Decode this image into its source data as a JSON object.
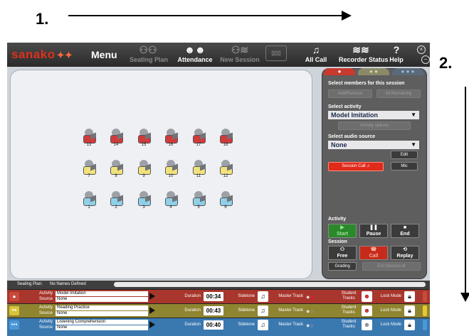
{
  "annotations": {
    "step1": "1.",
    "step2": "2."
  },
  "app": {
    "logo": "sanako",
    "menu": "Menu",
    "toolbar": [
      {
        "label": "Seating Plan",
        "icon": "seating-plan",
        "enabled": false
      },
      {
        "label": "Attendance",
        "icon": "attendance",
        "enabled": true
      },
      {
        "label": "New Session",
        "icon": "new-session",
        "enabled": false
      },
      {
        "label": "",
        "icon": "recorder-device",
        "enabled": false
      },
      {
        "label": "All Call",
        "icon": "all-call",
        "enabled": true
      },
      {
        "label": "Recorder Status",
        "icon": "recorder-status",
        "enabled": true
      },
      {
        "label": "Help",
        "icon": "help",
        "enabled": true
      }
    ],
    "window_buttons": [
      "close",
      "minimize"
    ]
  },
  "seats": {
    "row1": [
      "13",
      "14",
      "15",
      "16",
      "17",
      "18"
    ],
    "row2": [
      "7",
      "8",
      "9",
      "10",
      "11",
      "12"
    ],
    "row3": [
      "1",
      "2",
      "3",
      "4",
      "5",
      "6"
    ],
    "colors": {
      "row1": "#d03a3a",
      "row2": "#f2e27a",
      "row3": "#8fd0e8"
    }
  },
  "panel": {
    "tabs": [
      "●",
      "● ●",
      "● ● ●"
    ],
    "select_members": "Select members for this session",
    "add_remove": "Add/Remove",
    "all_remaining": "All Remaining",
    "select_activity": "Select activity",
    "activity_value": "Model Imitation",
    "activity_options": "Activity options",
    "select_audio": "Select audio source",
    "audio_value": "None",
    "edit": "Edit",
    "session_call": "Session Call",
    "mic": "Mic",
    "activity_heading": "Activity",
    "start": "Start",
    "pause": "Pause",
    "end": "End",
    "session_heading": "Session",
    "free": "Free",
    "call": "Call",
    "replay": "Replay",
    "grading": "Grading",
    "exit_session": "Exit Session"
  },
  "seating_plan": {
    "label": "Seating Plan:",
    "value": "No Names Defined"
  },
  "tracks": [
    {
      "tab": "●",
      "color": "#a8362c",
      "tab_color": "#c84a3a",
      "activity_label": "Activity",
      "activity": "Model Imitation",
      "source_label": "Source",
      "source": "None",
      "duration_label": "Duration",
      "duration": "00:34",
      "sidetone": "Sidetone",
      "master_track": "Master Track",
      "student_tracks": "Student Tracks",
      "lock_mode": "Lock Mode",
      "end_color": "#c84a3a"
    },
    {
      "tab": "●●",
      "color": "#8f8430",
      "tab_color": "#d8c43a",
      "activity_label": "Activity",
      "activity": "Reading Practice",
      "source_label": "Source",
      "source": "None",
      "duration_label": "Duration",
      "duration": "00:43",
      "sidetone": "Sidetone",
      "master_track": "Master Track",
      "student_tracks": "Student Tracks",
      "lock_mode": "Lock Mode",
      "end_color": "#e8c830"
    },
    {
      "tab": "●●●",
      "color": "#3a78b0",
      "tab_color": "#4a98d8",
      "activity_label": "Activity",
      "activity": "Listening Comprehension",
      "source_label": "Source",
      "source": "None",
      "duration_label": "Duration",
      "duration": "00:40",
      "sidetone": "Sidetone",
      "master_track": "Master Track",
      "student_tracks": "Student Tracks",
      "lock_mode": "Lock Mode",
      "end_color": "#4a98d8"
    }
  ]
}
